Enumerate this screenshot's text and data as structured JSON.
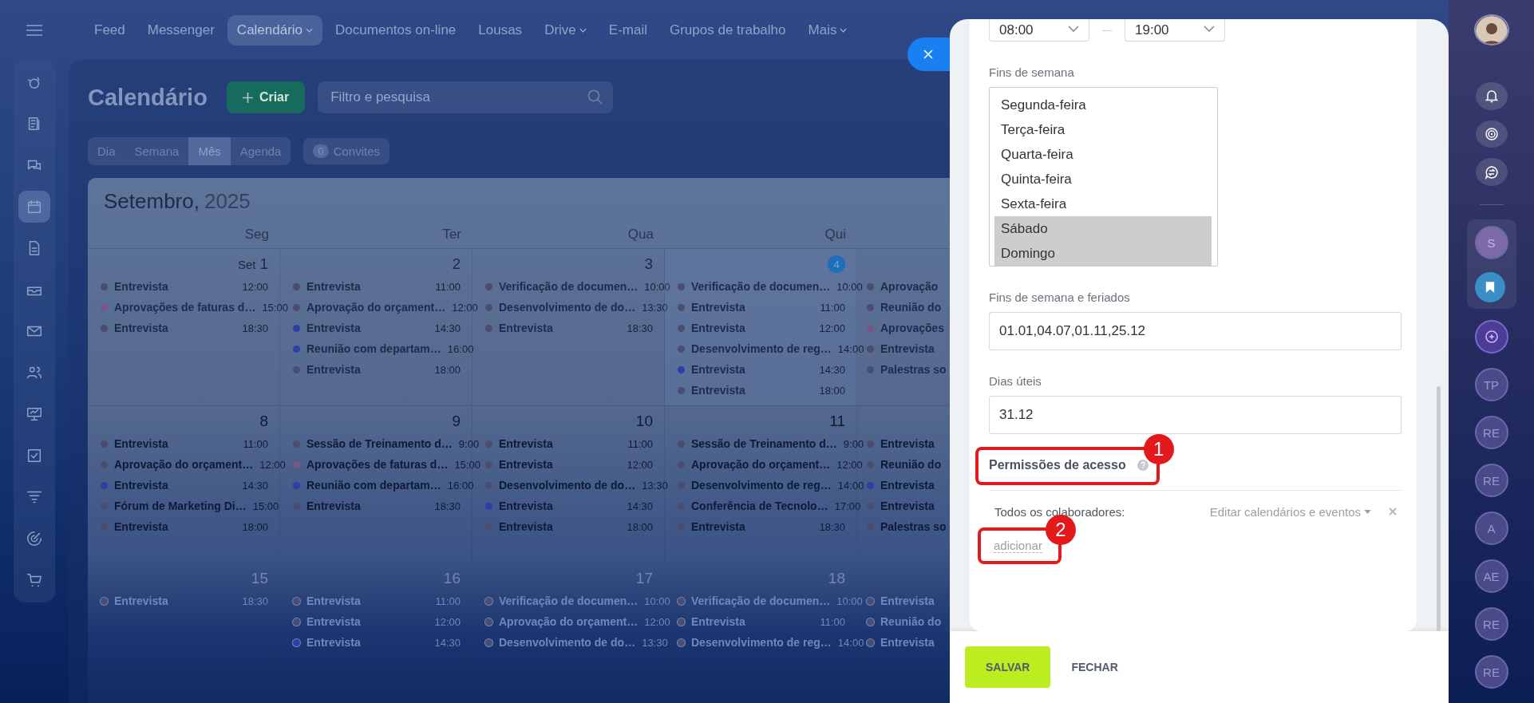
{
  "left_sidebar": {
    "items": [
      {
        "selected": false
      },
      {
        "selected": false
      },
      {
        "selected": false
      },
      {
        "selected": true
      },
      {
        "selected": false
      },
      {
        "selected": false
      },
      {
        "selected": false
      },
      {
        "selected": false
      },
      {
        "selected": false
      },
      {
        "selected": false
      },
      {
        "selected": false
      },
      {
        "selected": false
      },
      {
        "selected": false
      }
    ]
  },
  "top_nav": [
    {
      "label": "Feed",
      "selected": false,
      "dropdown": false
    },
    {
      "label": "Messenger",
      "selected": false,
      "dropdown": false
    },
    {
      "label": "Calendário",
      "selected": true,
      "dropdown": true
    },
    {
      "label": "Documentos on-line",
      "selected": false,
      "dropdown": false
    },
    {
      "label": "Lousas",
      "selected": false,
      "dropdown": false
    },
    {
      "label": "Drive",
      "selected": false,
      "dropdown": true
    },
    {
      "label": "E-mail",
      "selected": false,
      "dropdown": false
    },
    {
      "label": "Grupos de trabalho",
      "selected": false,
      "dropdown": false
    },
    {
      "label": "Mais",
      "selected": false,
      "dropdown": true
    }
  ],
  "header": {
    "title": "Calendário",
    "create_button": "Criar",
    "search": {
      "placeholder": "Filtro e pesquisa"
    }
  },
  "view_tabs": [
    {
      "label": "Dia",
      "selected": false
    },
    {
      "label": "Semana",
      "selected": false
    },
    {
      "label": "Mês",
      "selected": true
    },
    {
      "label": "Agenda",
      "selected": false
    }
  ],
  "invites": {
    "count": "0",
    "label": "Convites"
  },
  "calendar": {
    "month": "Setembro,",
    "year": "2025",
    "weekdays": [
      "Seg",
      "Ter",
      "Qua",
      "Qui"
    ],
    "weeks": [
      {
        "days": [
          {
            "prefix": "Set",
            "day": "1",
            "today": false,
            "events": [
              {
                "title": "Entrevista",
                "time": "12:00",
                "color": "#4a4d6e"
              },
              {
                "title": "Aprovações de faturas d…",
                "time": "15:00",
                "color": "#7a5685"
              },
              {
                "title": "Entrevista",
                "time": "18:30",
                "color": "#4a4d6e"
              }
            ]
          },
          {
            "day": "2",
            "today": false,
            "events": [
              {
                "title": "Entrevista",
                "time": "11:00",
                "color": "#4a4d6e"
              },
              {
                "title": "Aprovação do orçament…",
                "time": "12:00",
                "color": "#4a4d6e"
              },
              {
                "title": "Entrevista",
                "time": "14:30",
                "color": "#2c3fa8"
              },
              {
                "title": "Reunião com departam…",
                "time": "16:00",
                "color": "#2c3fa8"
              },
              {
                "title": "Entrevista",
                "time": "18:00",
                "color": "#4a4d6e"
              }
            ]
          },
          {
            "day": "3",
            "today": false,
            "events": [
              {
                "title": "Verificação de documen…",
                "time": "10:00",
                "color": "#4a4d6e"
              },
              {
                "title": "Desenvolvimento de do…",
                "time": "13:30",
                "color": "#4a4d6e"
              },
              {
                "title": "Entrevista",
                "time": "18:30",
                "color": "#4a4d6e"
              }
            ]
          },
          {
            "day": "4",
            "today": true,
            "events": [
              {
                "title": "Verificação de documen…",
                "time": "10:00",
                "color": "#4a4d6e"
              },
              {
                "title": "Entrevista",
                "time": "11:00",
                "color": "#4a4d6e"
              },
              {
                "title": "Entrevista",
                "time": "12:00",
                "color": "#4a4d6e"
              },
              {
                "title": "Desenvolvimento de reg…",
                "time": "14:00",
                "color": "#4a4d6e"
              },
              {
                "title": "Entrevista",
                "time": "14:30",
                "color": "#2c3fa8"
              },
              {
                "title": "Entrevista",
                "time": "18:00",
                "color": "#4a4d6e"
              }
            ]
          },
          {
            "events": [
              {
                "title": "Aprovação",
                "color": "#4a4d6e"
              },
              {
                "title": "Reunião do",
                "color": "#4a4d6e"
              },
              {
                "title": "Aprovações",
                "color": "#7a5685"
              },
              {
                "title": "Entrevista",
                "color": "#4a4d6e"
              },
              {
                "title": "Palestras so",
                "color": "#4a4d6e"
              }
            ]
          }
        ]
      },
      {
        "days": [
          {
            "day": "8",
            "today": false,
            "events": [
              {
                "title": "Entrevista",
                "time": "11:00",
                "color": "#4a4d6e"
              },
              {
                "title": "Aprovação do orçament…",
                "time": "12:00",
                "color": "#4a4d6e"
              },
              {
                "title": "Entrevista",
                "time": "14:30",
                "color": "#2c3fa8"
              },
              {
                "title": "Fórum de Marketing Di…",
                "time": "15:00",
                "color": "#4a4d6e"
              },
              {
                "title": "Entrevista",
                "time": "18:00",
                "color": "#4a4d6e"
              }
            ]
          },
          {
            "day": "9",
            "today": false,
            "events": [
              {
                "title": "Sessão de Treinamento d…",
                "time": "9:00",
                "color": "#4a4d6e"
              },
              {
                "title": "Aprovações de faturas d…",
                "time": "15:00",
                "color": "#7a5685"
              },
              {
                "title": "Reunião com departam…",
                "time": "16:00",
                "color": "#2c3fa8"
              },
              {
                "title": "Entrevista",
                "time": "18:30",
                "color": "#4a4d6e"
              }
            ]
          },
          {
            "day": "10",
            "today": false,
            "events": [
              {
                "title": "Entrevista",
                "time": "11:00",
                "color": "#4a4d6e"
              },
              {
                "title": "Entrevista",
                "time": "12:00",
                "color": "#4a4d6e"
              },
              {
                "title": "Desenvolvimento de do…",
                "time": "13:30",
                "color": "#4a4d6e"
              },
              {
                "title": "Entrevista",
                "time": "14:30",
                "color": "#2c3fa8"
              },
              {
                "title": "Entrevista",
                "time": "18:00",
                "color": "#4a4d6e"
              }
            ]
          },
          {
            "day": "11",
            "today": false,
            "events": [
              {
                "title": "Sessão de Treinamento d…",
                "time": "9:00",
                "color": "#4a4d6e"
              },
              {
                "title": "Aprovação do orçament…",
                "time": "12:00",
                "color": "#4a4d6e"
              },
              {
                "title": "Desenvolvimento de reg…",
                "time": "14:00",
                "color": "#4a4d6e"
              },
              {
                "title": "Conferência de Tecnolo…",
                "time": "17:00",
                "color": "#4a4d6e"
              },
              {
                "title": "Entrevista",
                "time": "18:30",
                "color": "#4a4d6e"
              }
            ]
          },
          {
            "events": [
              {
                "title": "Entrevista",
                "color": "#4a4d6e"
              },
              {
                "title": "Reunião do",
                "color": "#4a4d6e"
              },
              {
                "title": "Entrevista",
                "color": "#2c3fa8"
              },
              {
                "title": "Entrevista",
                "color": "#4a4d6e"
              },
              {
                "title": "Palestras so",
                "color": "#4a4d6e"
              }
            ]
          }
        ]
      },
      {
        "days": [
          {
            "day": "15",
            "today": false,
            "events": [
              {
                "title": "Entrevista",
                "time": "18:30",
                "color": "#4a4d6e"
              }
            ]
          },
          {
            "day": "16",
            "today": false,
            "events": [
              {
                "title": "Entrevista",
                "time": "11:00",
                "color": "#4a4d6e"
              },
              {
                "title": "Entrevista",
                "time": "12:00",
                "color": "#4a4d6e"
              },
              {
                "title": "Entrevista",
                "time": "14:30",
                "color": "#2c3fa8"
              }
            ]
          },
          {
            "day": "17",
            "today": false,
            "events": [
              {
                "title": "Verificação de documen…",
                "time": "10:00",
                "color": "#4a4d6e"
              },
              {
                "title": "Aprovação do orçament…",
                "time": "12:00",
                "color": "#4a4d6e"
              },
              {
                "title": "Desenvolvimento de do…",
                "time": "13:30",
                "color": "#4a4d6e"
              }
            ]
          },
          {
            "day": "18",
            "today": false,
            "events": [
              {
                "title": "Verificação de documen…",
                "time": "10:00",
                "color": "#4a4d6e"
              },
              {
                "title": "Entrevista",
                "time": "11:00",
                "color": "#4a4d6e"
              },
              {
                "title": "Desenvolvimento de reg…",
                "time": "14:00",
                "color": "#4a4d6e"
              }
            ]
          },
          {
            "events": [
              {
                "title": "Entrevista",
                "color": "#4a4d6e"
              },
              {
                "title": "Reunião do",
                "color": "#4a4d6e"
              },
              {
                "title": "Entrevista",
                "color": "#4a4d6e"
              }
            ]
          }
        ]
      }
    ]
  },
  "panel": {
    "work_hours": {
      "from": "08:00",
      "to": "19:00"
    },
    "weekends": {
      "label": "Fins de semana",
      "options": [
        {
          "label": "Segunda-feira",
          "selected": false
        },
        {
          "label": "Terça-feira",
          "selected": false
        },
        {
          "label": "Quarta-feira",
          "selected": false
        },
        {
          "label": "Quinta-feira",
          "selected": false
        },
        {
          "label": "Sexta-feira",
          "selected": false
        },
        {
          "label": "Sábado",
          "selected": true
        },
        {
          "label": "Domingo",
          "selected": true
        }
      ]
    },
    "holidays": {
      "label": "Fins de semana e feriados",
      "value": "01.01,04.07,01.11,25.12"
    },
    "workdays": {
      "label": "Dias úteis",
      "value": "31.12"
    },
    "permissions": {
      "title": "Permissões de acesso",
      "callout": "1",
      "rows": [
        {
          "who": "Todos os colaboradores:",
          "access": "Editar calendários e eventos"
        }
      ],
      "add_link": "adicionar",
      "add_callout": "2"
    },
    "buttons": [
      {
        "label": "SALVAR",
        "kind": "primary"
      },
      {
        "label": "FECHAR",
        "kind": "link"
      }
    ]
  },
  "right_bar": {
    "chats": [
      {
        "kind": "initials",
        "text": "S",
        "pinned": true
      },
      {
        "kind": "bookmark",
        "pinned": true
      },
      {
        "kind": "assistant",
        "pinned": false
      },
      {
        "kind": "initials",
        "text": "TP",
        "pinned": false
      },
      {
        "kind": "initials",
        "text": "RE",
        "pinned": false
      },
      {
        "kind": "initials",
        "text": "RE",
        "pinned": false
      },
      {
        "kind": "initials",
        "text": "A",
        "pinned": false
      },
      {
        "kind": "initials",
        "text": "AE",
        "pinned": false
      },
      {
        "kind": "initials",
        "text": "RE",
        "pinned": false
      },
      {
        "kind": "initials",
        "text": "RE",
        "pinned": false
      }
    ]
  }
}
